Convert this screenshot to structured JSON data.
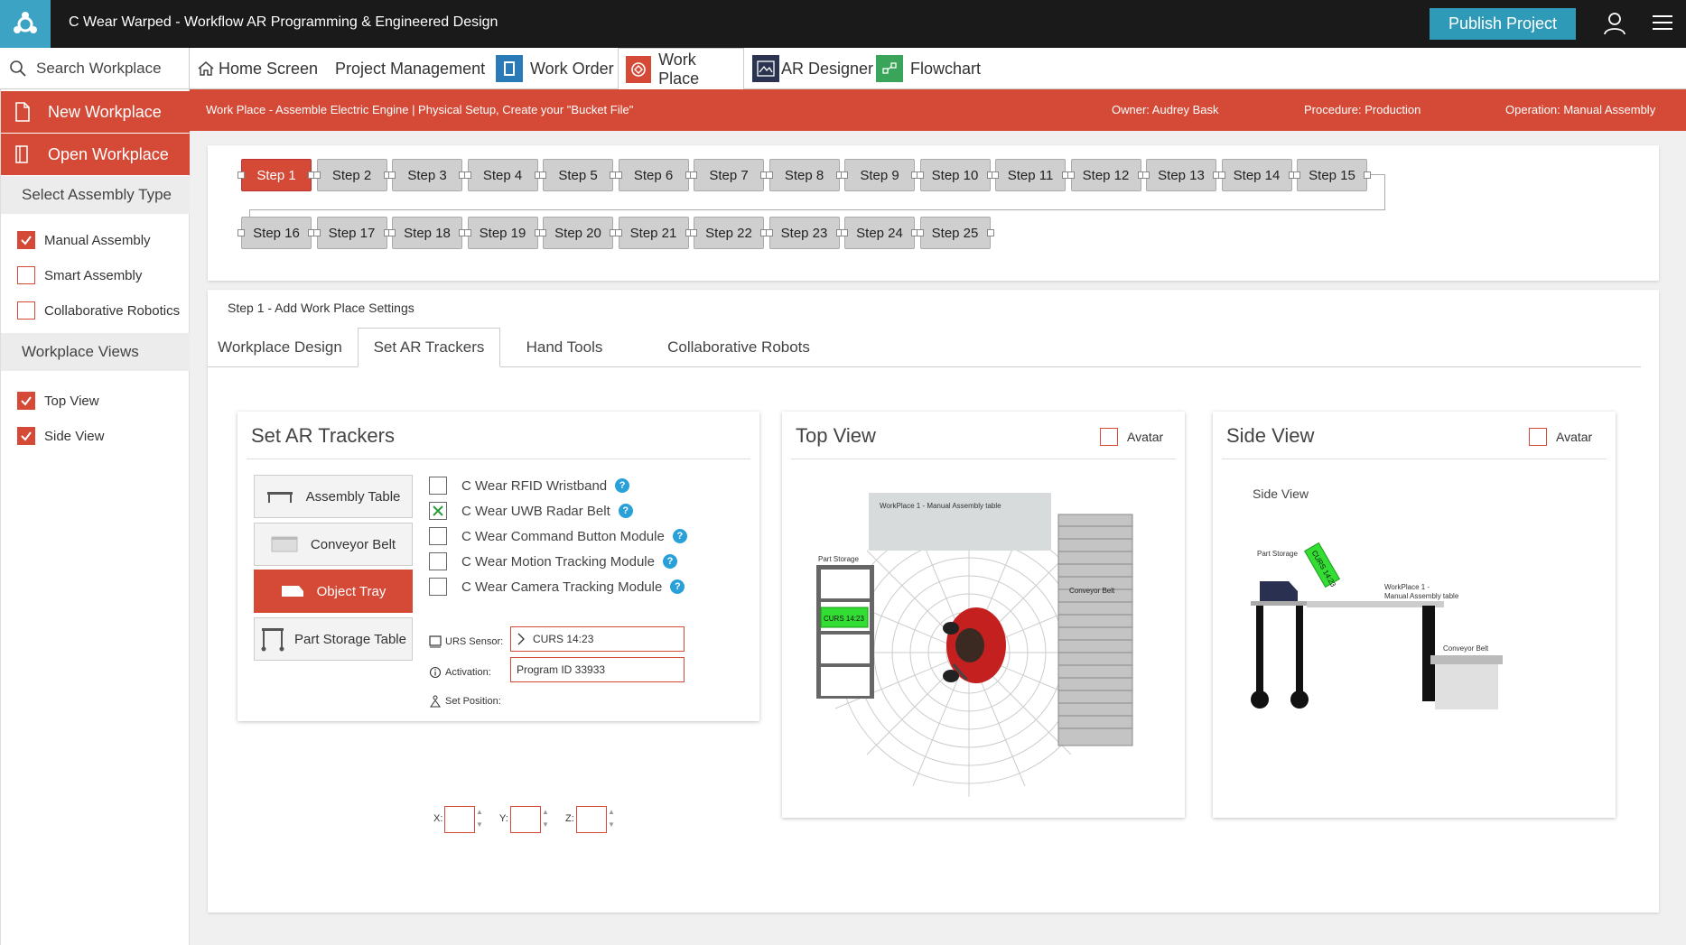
{
  "app": {
    "title": "C Wear Warped - Workflow AR Programming & Engineered Design",
    "publish_label": "Publish Project"
  },
  "nav": {
    "search_label": "Search Workplace",
    "items": [
      {
        "label": "Home Screen",
        "icon": "home-icon"
      },
      {
        "label": "Project Management",
        "icon": ""
      },
      {
        "label": "Work Order",
        "icon": "work-order-icon"
      },
      {
        "label": "Work Place",
        "icon": "work-place-icon"
      },
      {
        "label": "AR Designer",
        "icon": "ar-designer-icon"
      },
      {
        "label": "Flowchart",
        "icon": "flowchart-icon"
      }
    ]
  },
  "sidebar": {
    "new_workplace": "New Workplace",
    "open_workplace": "Open Workplace",
    "assembly_header": "Select Assembly Type",
    "assembly_types": [
      {
        "label": "Manual Assembly",
        "checked": true
      },
      {
        "label": "Smart Assembly",
        "checked": false
      },
      {
        "label": "Collaborative Robotics",
        "checked": false
      }
    ],
    "views_header": "Workplace Views",
    "views": [
      {
        "label": "Top View",
        "checked": true
      },
      {
        "label": "Side View",
        "checked": true
      }
    ]
  },
  "infobar": {
    "context": "Work Place - Assemble Electric Engine | Physical Setup, Create your \"Bucket File\"",
    "owner": "Owner: Audrey Bask",
    "procedure": "Procedure: Production",
    "operation": "Operation: Manual Assembly"
  },
  "steps": [
    "Step 1",
    "Step 2",
    "Step 3",
    "Step 4",
    "Step 5",
    "Step 6",
    "Step 7",
    "Step 8",
    "Step 9",
    "Step 10",
    "Step 11",
    "Step 12",
    "Step 13",
    "Step 14",
    "Step 15",
    "Step 16",
    "Step 17",
    "Step 18",
    "Step 19",
    "Step 20",
    "Step 21",
    "Step 22",
    "Step 23",
    "Step 24",
    "Step 25"
  ],
  "active_step": "Step 1",
  "settings": {
    "title": "Step 1 - Add Work Place Settings",
    "tabs": [
      "Workplace Design",
      "Set AR Trackers",
      "Hand Tools",
      "Collaborative Robots"
    ],
    "active_tab": "Set AR Trackers"
  },
  "trackers_card": {
    "title": "Set AR Trackers",
    "buttons": [
      "Assembly Table",
      "Conveyor Belt",
      "Object Tray",
      "Part Storage Table"
    ],
    "active_button": "Object Tray",
    "options": [
      {
        "label": "C Wear RFID Wristband",
        "checked": false
      },
      {
        "label": "C Wear UWB Radar Belt",
        "checked": true
      },
      {
        "label": "C Wear Command Button Module",
        "checked": false
      },
      {
        "label": "C Wear Motion Tracking Module",
        "checked": false
      },
      {
        "label": "C Wear Camera Tracking Module",
        "checked": false
      }
    ],
    "urs_label": "URS Sensor:",
    "urs_value": "CURS 14:23",
    "activation_label": "Activation:",
    "activation_value": "Program ID 33933",
    "set_position_label": "Set Position:",
    "x_label": "X:",
    "y_label": "Y:",
    "z_label": "Z:"
  },
  "top_view": {
    "title": "Top View",
    "avatar_label": "Avatar",
    "workplace_label": "WorkPlace 1 - Manual Assembly table",
    "part_storage_label": "Part Storage",
    "curs_label": "CURS 14:23",
    "conveyor_label": "Conveyor Belt"
  },
  "side_view": {
    "title": "Side View",
    "avatar_label": "Avatar",
    "inner_label": "Side View",
    "part_storage_label": "Part Storage",
    "curs_label": "CURS 14:23",
    "workplace_label_1": "WorkPlace 1 -",
    "workplace_label_2": "Manual Assembly table",
    "conveyor_label": "Conveyor Belt"
  },
  "colors": {
    "accent": "#d54a37",
    "publish": "#2f9ab8",
    "titlebar": "#1a1a1a",
    "help": "#2aa0d8",
    "sensor_green": "#33dd33"
  }
}
